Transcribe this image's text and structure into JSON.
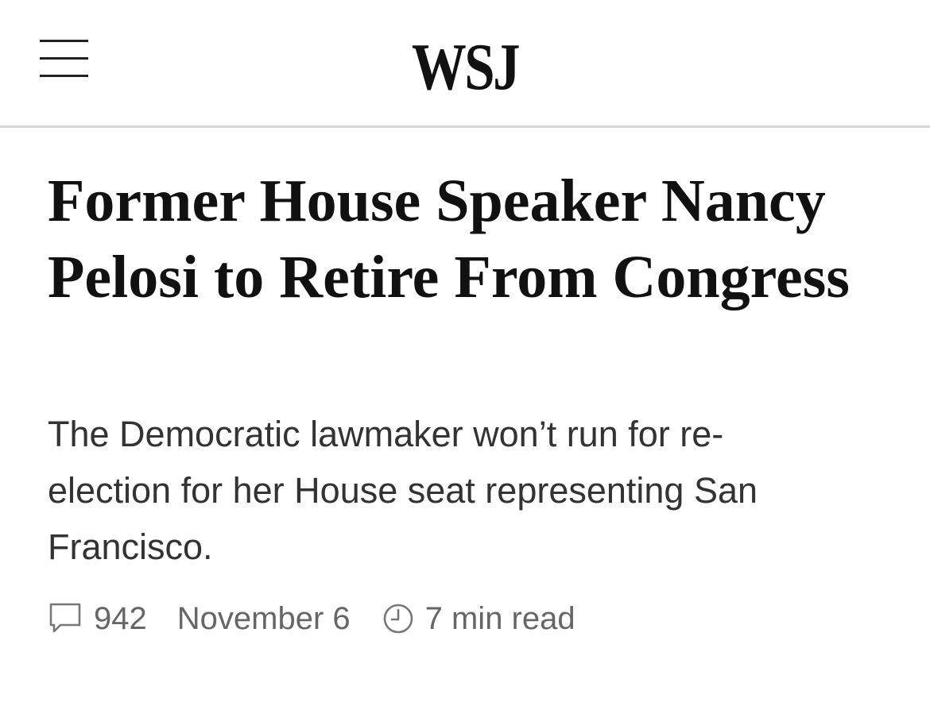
{
  "header": {
    "logo_text": "WSJ"
  },
  "article": {
    "headline": "Former House Speaker Nancy Pelosi to Retire From Congress",
    "dek": "The Democratic lawmaker won’t run for re-election for her House seat representing San Francisco.",
    "comment_count": "942",
    "date": "November 6",
    "read_time": "7 min read"
  },
  "icons": {
    "menu": "hamburger-menu-icon",
    "comments": "comment-bubble-icon",
    "read_time": "clock-icon"
  },
  "colors": {
    "text": "#111111",
    "dek": "#333333",
    "meta": "#666666",
    "divider": "#d6d6d6"
  }
}
